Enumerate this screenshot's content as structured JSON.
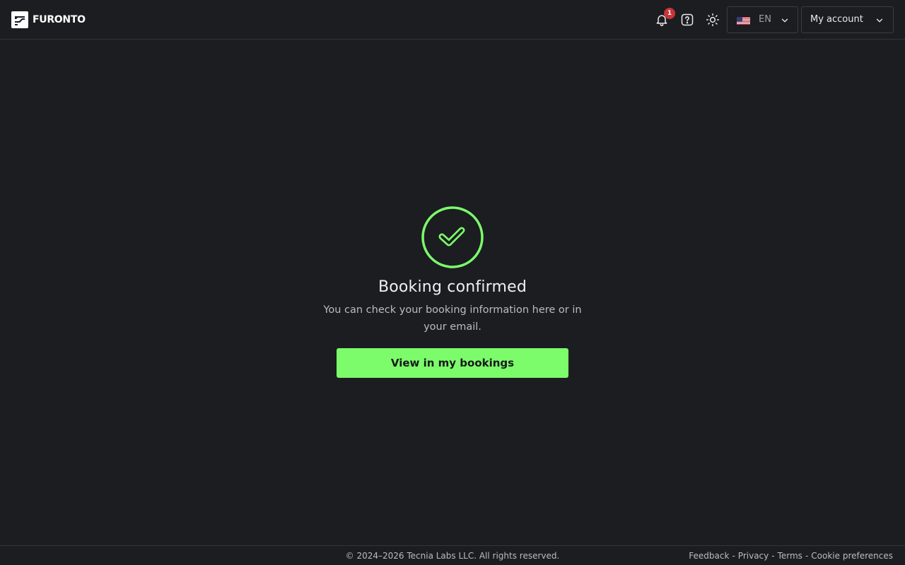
{
  "header": {
    "logo_text": "FURONTO",
    "notification_count": "1",
    "language": {
      "code": "EN"
    },
    "account_label": "My account"
  },
  "main": {
    "title": "Booking confirmed",
    "description": "You can check your booking information here or in your email.",
    "primary_button": "View in my bookings"
  },
  "footer": {
    "copyright": "© 2024–2026 Tecnia Labs LLC. All rights reserved.",
    "links": [
      "Feedback",
      "Privacy",
      "Terms",
      "Cookie preferences"
    ],
    "separator": "-"
  },
  "colors": {
    "background": "#1b1d21",
    "accent": "#7cfc6a",
    "badge": "#c9343a",
    "border": "#33363c"
  }
}
